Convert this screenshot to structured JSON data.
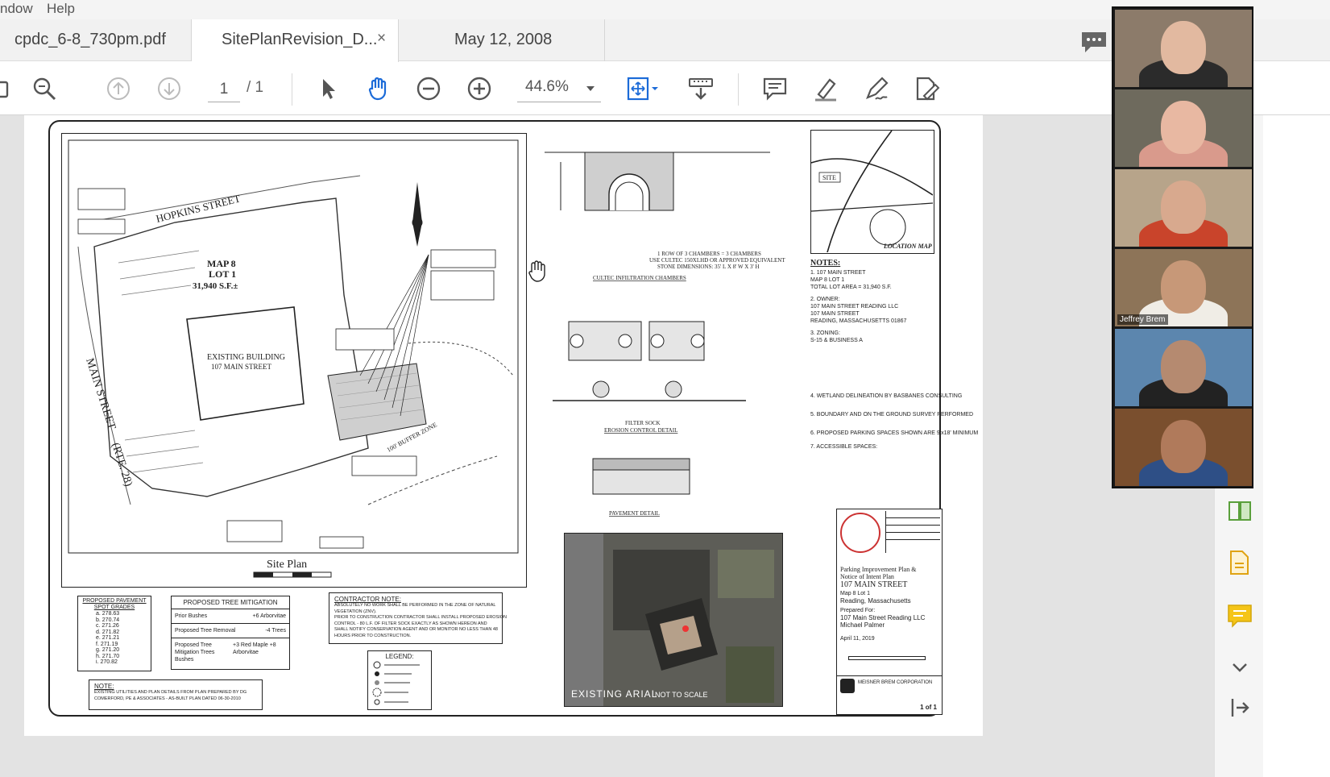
{
  "menu": {
    "items": [
      "ndow",
      "Help"
    ]
  },
  "tabs": [
    {
      "label": "cpdc_6-8_730pm.pdf",
      "active": false
    },
    {
      "label": "SitePlanRevision_D...",
      "active": true,
      "close": "×"
    },
    {
      "label": "May 12, 2008",
      "active": false
    }
  ],
  "toolbar": {
    "page_current": "1",
    "page_total": "/ 1",
    "zoom": "44.6%",
    "accent_color": "#1c6bd8"
  },
  "drawing": {
    "site_plan_title": "Site Plan",
    "street_hopkins": "HOPKINS STREET",
    "street_main": "MAIN STREET",
    "route": "(RTE. 28)",
    "map_lot": "MAP 8",
    "lot": "LOT 1",
    "area": "31,940 S.F.±",
    "existing_building": "EXISTING BUILDING",
    "building_address": "107 MAIN STREET",
    "buffer_zone": "100' BUFFER ZONE",
    "chambers_title": "CULTEC INFILTRATION CHAMBERS",
    "chambers_note": "1 ROW OF 3 CHAMBERS = 3 CHAMBERS",
    "chambers_note2": "USE CULTEC 150XLHD OR APPROVED EQUIVALENT",
    "chambers_dims": "STONE DIMENSIONS: 35' L X 8' W X 3' H",
    "filter_sock": "FILTER SOCK",
    "erosion_detail": "EROSION CONTROL DETAIL",
    "pavement_detail": "PAVEMENT DETAIL",
    "location_map": "LOCATION MAP",
    "site_label": "SITE",
    "notes_title": "NOTES:",
    "notes": [
      "1. 107 MAIN STREET",
      "MAP 8 LOT 1",
      "TOTAL LOT AREA = 31,940 S.F.",
      "2. OWNER:",
      "107 MAIN STREET READING LLC",
      "107 MAIN STREET",
      "READING, MASSACHUSETTS 01867",
      "3. ZONING:",
      "S-15 & BUSINESS A",
      "4. WETLAND DELINEATION BY BASBANES CONSULTING",
      "5. BOUNDARY AND ON THE GROUND SURVEY PERFORMED",
      "6. PROPOSED PARKING SPACES SHOWN ARE 9'x18' MINIMUM",
      "7. ACCESSIBLE SPACES:"
    ],
    "aerial_label": "EXISTING ARIAL",
    "aerial_scale": "NOT TO SCALE",
    "title_block": {
      "plan_name": "Parking Improvement Plan &",
      "plan_name2": "Notice of Intent Plan",
      "address": "107 MAIN STREET",
      "map_lot": "Map 8 Lot 1",
      "city": "Reading, Massachusetts",
      "prepared_for": "Prepared For:",
      "client": "107 Main Street Reading LLC",
      "client2": "Michael Palmer",
      "date": "April 11, 2019",
      "company": "MEISNER BREM CORPORATION",
      "sheet": "1 of 1"
    },
    "spot_grades_title": "PROPOSED PAVEMENT SPOT GRADES",
    "spot_grades": [
      "a. 278.63",
      "b. 270.74",
      "c. 271.26",
      "d. 271.82",
      "e. 271.21",
      "f. 271.19",
      "g. 271.20",
      "h. 271.70",
      "i. 270.82"
    ],
    "tree_title": "PROPOSED TREE MITIGATION",
    "tree_rows": [
      {
        "left": "Prior Bushes",
        "right": "+6 Arborvitae"
      },
      {
        "left": "Proposed Tree Removal",
        "right": "-4 Trees"
      },
      {
        "left": "Proposed Tree Mitigation Trees Bushes",
        "right": "+3 Red Maple +8 Arborvitae"
      }
    ],
    "contractor_title": "CONTRACTOR NOTE:",
    "contractor_text": [
      "ABSOLUTELY NO WORK SHALL BE PERFORMED IN THE ZONE OF NATURAL",
      "VEGETATION (ZNV).",
      "PRIOR TO CONSTRUCTION CONTRACTOR SHALL INSTALL PROPOSED EROSION",
      "CONTROL - 80 L.F. OF FILTER SOCK EXACTLY AS SHOWN HEREON AND",
      "SHALL NOTIFY CONSERVATION AGENT AND OR MONITOR NO LESS THAN 48",
      "HOURS PRIOR TO CONSTRUCTION."
    ],
    "legend_title": "LEGEND:",
    "note_title": "NOTE:",
    "note_text": [
      "EXISTING UTILITIES AND PLAN DETAILS FROM PLAN PREPARED BY DG",
      "COMERFORD, PE & ASSOCIATES - AS-BUILT PLAN DATED 06-30-2010"
    ]
  },
  "participants": [
    {
      "name": "",
      "bg": "#8c7b6a",
      "face": "#e2b9a0",
      "shirt": "#2b2b2b"
    },
    {
      "name": "",
      "bg": "#6e6a5d",
      "face": "#e8b8a2",
      "shirt": "#d99a8c"
    },
    {
      "name": "",
      "bg": "#b7a48a",
      "face": "#d8a98e",
      "shirt": "#c9442b"
    },
    {
      "name": "Jeffrey Brem",
      "bg": "#8d7458",
      "face": "#c79878",
      "shirt": "#f0ede6"
    },
    {
      "name": "",
      "bg": "#5c86ae",
      "face": "#b58a70",
      "shirt": "#222"
    },
    {
      "name": "",
      "bg": "#7a4f2e",
      "face": "#b07a5b",
      "shirt": "#2e4f86"
    }
  ],
  "icons": [
    "menu-icon",
    "zoom-search-icon",
    "page-up-icon",
    "page-down-icon",
    "select-arrow-icon",
    "hand-tool-icon",
    "zoom-out-icon",
    "zoom-in-icon",
    "fit-page-icon",
    "scroll-mode-icon",
    "comment-icon",
    "highlight-icon",
    "sign-icon",
    "edit-pdf-icon",
    "chat-icon",
    "compare-icon",
    "export-pdf-icon",
    "sticky-note-icon",
    "chevron-down-icon",
    "collapse-panel-icon"
  ]
}
